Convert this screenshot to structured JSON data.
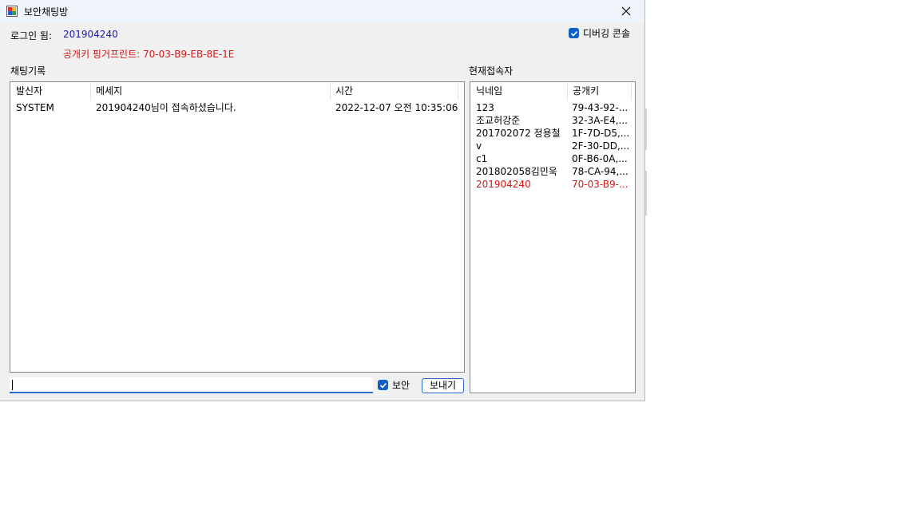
{
  "window": {
    "title": "보안채팅방",
    "close_label": "✕"
  },
  "login": {
    "label": "로그인 됨:",
    "user_id": "201904240"
  },
  "fingerprint": {
    "label": "공개키 핑거프린트:",
    "value": "70-03-B9-EB-8E-1E"
  },
  "debug_console": {
    "label": "디버깅 콘솔",
    "checked": true
  },
  "chat_log": {
    "title": "채팅기록",
    "columns": [
      "발신자",
      "메세지",
      "시간"
    ],
    "rows": [
      {
        "sender": "SYSTEM",
        "message": "201904240님이 접속하셨습니다.",
        "time": "2022-12-07 오전 10:35:06"
      }
    ]
  },
  "users": {
    "title": "현재접속자",
    "columns": [
      "닉네임",
      "공개키"
    ],
    "rows": [
      {
        "nickname": "123",
        "key": "79-43-92-...",
        "highlight": false
      },
      {
        "nickname": "조교허강준",
        "key": "32-3A-E4,...",
        "highlight": false
      },
      {
        "nickname": "201702072 정용철",
        "key": "1F-7D-D5,...",
        "highlight": false
      },
      {
        "nickname": "v",
        "key": "2F-30-DD,...",
        "highlight": false
      },
      {
        "nickname": "c1",
        "key": "0F-B6-0A,...",
        "highlight": false
      },
      {
        "nickname": "201802058김민욱",
        "key": "78-CA-94,...",
        "highlight": false
      },
      {
        "nickname": "201904240",
        "key": "70-03-B9-...",
        "highlight": true
      }
    ]
  },
  "composer": {
    "input_value": "",
    "secure_label": "보안",
    "secure_checked": true,
    "send_label": "보내기"
  },
  "colors": {
    "highlight": "#d01818",
    "accent": "#1060c8",
    "user_id": "#1a1aa6"
  }
}
